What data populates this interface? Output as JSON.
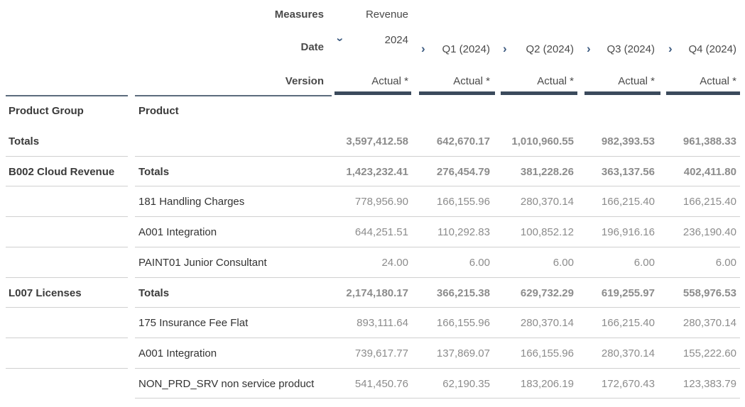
{
  "header": {
    "measures_label": "Measures",
    "measures_value": "Revenue",
    "date_label": "Date",
    "year": "2024",
    "quarters": [
      "Q1 (2024)",
      "Q2 (2024)",
      "Q3 (2024)",
      "Q4 (2024)"
    ],
    "version_label": "Version",
    "versions": [
      "Actual *",
      "Actual *",
      "Actual *",
      "Actual *",
      "Actual *"
    ]
  },
  "row_headers": {
    "product_group": "Product Group",
    "product": "Product"
  },
  "rows": [
    {
      "group": "Totals",
      "product": "",
      "values": [
        "3,597,412.58",
        "642,670.17",
        "1,010,960.55",
        "982,393.53",
        "961,388.33"
      ],
      "total": true
    },
    {
      "group": "B002 Cloud Revenue",
      "product": "Totals",
      "values": [
        "1,423,232.41",
        "276,454.79",
        "381,228.26",
        "363,137.56",
        "402,411.80"
      ],
      "total": true
    },
    {
      "group": "",
      "product": "181 Handling Charges",
      "values": [
        "778,956.90",
        "166,155.96",
        "280,370.14",
        "166,215.40",
        "166,215.40"
      ],
      "total": false
    },
    {
      "group": "",
      "product": "A001 Integration",
      "values": [
        "644,251.51",
        "110,292.83",
        "100,852.12",
        "196,916.16",
        "236,190.40"
      ],
      "total": false
    },
    {
      "group": "",
      "product": "PAINT01 Junior Consultant",
      "values": [
        "24.00",
        "6.00",
        "6.00",
        "6.00",
        "6.00"
      ],
      "total": false
    },
    {
      "group": "L007 Licenses",
      "product": "Totals",
      "values": [
        "2,174,180.17",
        "366,215.38",
        "629,732.29",
        "619,255.97",
        "558,976.53"
      ],
      "total": true
    },
    {
      "group": "",
      "product": "175 Insurance Fee Flat",
      "values": [
        "893,111.64",
        "166,155.96",
        "280,370.14",
        "166,215.40",
        "280,370.14"
      ],
      "total": false
    },
    {
      "group": "",
      "product": "A001 Integration",
      "values": [
        "739,617.77",
        "137,869.07",
        "166,155.96",
        "280,370.14",
        "155,222.60"
      ],
      "total": false
    },
    {
      "group": "",
      "product": "NON_PRD_SRV non service product",
      "values": [
        "541,450.76",
        "62,190.35",
        "183,206.19",
        "172,670.43",
        "123,383.79"
      ],
      "total": false
    }
  ],
  "icons": {
    "expanded": "chevron-down-icon",
    "collapsed": "chevron-right-icon"
  }
}
